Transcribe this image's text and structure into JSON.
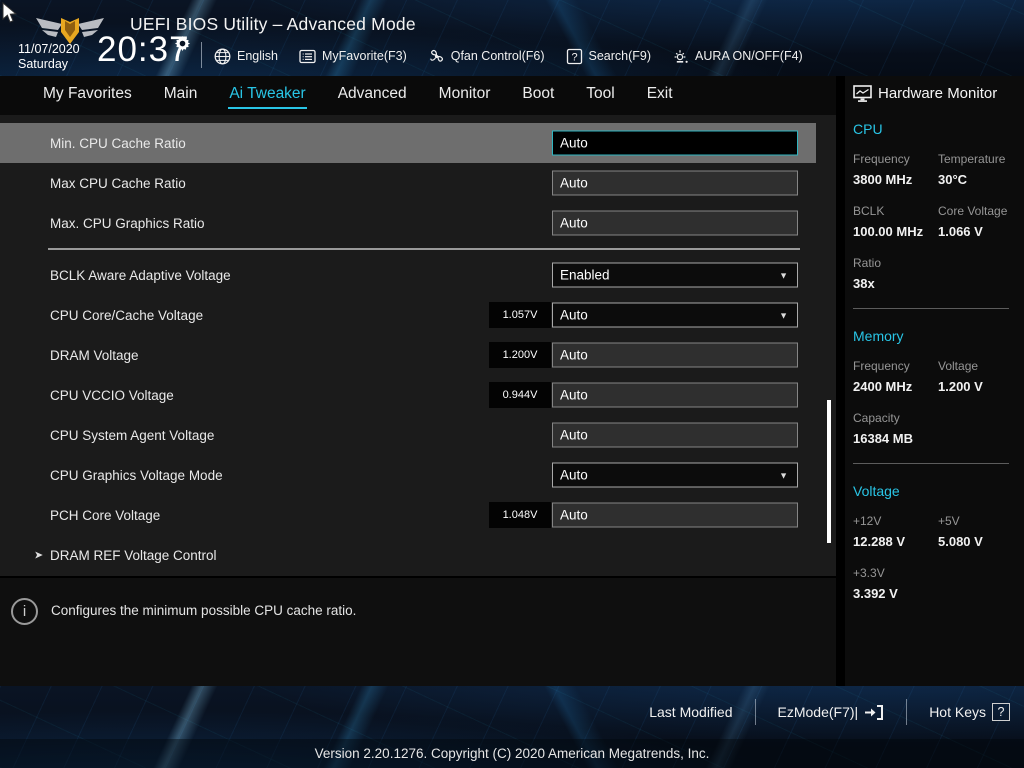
{
  "colors": {
    "accent_cyan": "#29c5e6",
    "selected_row": "#6e6e6e",
    "selected_border": "#2fb5c0"
  },
  "icons": {
    "caret_down": "▼",
    "submenu_arrow": "➤",
    "info_glyph": "i"
  },
  "header": {
    "title": "UEFI BIOS Utility – Advanced Mode",
    "date": "11/07/2020",
    "day": "Saturday",
    "time": "20:37",
    "toolbar": [
      {
        "label": "English",
        "icon": "globe-icon"
      },
      {
        "label": "MyFavorite(F3)",
        "icon": "myfavorite-icon"
      },
      {
        "label": "Qfan Control(F6)",
        "icon": "qfan-icon"
      },
      {
        "label": "Search(F9)",
        "icon": "search-icon"
      },
      {
        "label": "AURA ON/OFF(F4)",
        "icon": "aura-icon"
      }
    ]
  },
  "tabs": [
    {
      "label": "My Favorites",
      "active": false
    },
    {
      "label": "Main",
      "active": false
    },
    {
      "label": "Ai Tweaker",
      "active": true
    },
    {
      "label": "Advanced",
      "active": false
    },
    {
      "label": "Monitor",
      "active": false
    },
    {
      "label": "Boot",
      "active": false
    },
    {
      "label": "Tool",
      "active": false
    },
    {
      "label": "Exit",
      "active": false
    }
  ],
  "settings": {
    "rows": [
      {
        "label": "Min. CPU Cache Ratio",
        "value": "Auto",
        "control": "input",
        "selected": true
      },
      {
        "label": "Max CPU Cache Ratio",
        "value": "Auto",
        "control": "input"
      },
      {
        "label": "Max. CPU Graphics Ratio",
        "value": "Auto",
        "control": "input"
      },
      {
        "label": "BCLK Aware Adaptive Voltage",
        "value": "Enabled",
        "control": "dropdown",
        "separator_before": true
      },
      {
        "label": "CPU Core/Cache Voltage",
        "chip": "1.057V",
        "value": "Auto",
        "control": "dropdown"
      },
      {
        "label": "DRAM Voltage",
        "chip": "1.200V",
        "value": "Auto",
        "control": "input"
      },
      {
        "label": "CPU VCCIO Voltage",
        "chip": "0.944V",
        "value": "Auto",
        "control": "input"
      },
      {
        "label": "CPU System Agent Voltage",
        "value": "Auto",
        "control": "input"
      },
      {
        "label": "CPU Graphics Voltage Mode",
        "value": "Auto",
        "control": "dropdown"
      },
      {
        "label": "PCH Core Voltage",
        "chip": "1.048V",
        "value": "Auto",
        "control": "input"
      },
      {
        "label": "DRAM REF Voltage Control",
        "control": "submenu"
      }
    ]
  },
  "info": {
    "text": "Configures the minimum possible CPU cache ratio."
  },
  "hardware_monitor": {
    "title": "Hardware Monitor",
    "sections": [
      {
        "name": "CPU",
        "groups": [
          [
            {
              "label": "Frequency",
              "value": "3800 MHz"
            },
            {
              "label": "Temperature",
              "value": "30°C"
            }
          ],
          [
            {
              "label": "BCLK",
              "value": "100.00 MHz"
            },
            {
              "label": "Core Voltage",
              "value": "1.066 V"
            }
          ],
          [
            {
              "label": "Ratio",
              "value": "38x"
            }
          ]
        ]
      },
      {
        "name": "Memory",
        "groups": [
          [
            {
              "label": "Frequency",
              "value": "2400 MHz"
            },
            {
              "label": "Voltage",
              "value": "1.200 V"
            }
          ],
          [
            {
              "label": "Capacity",
              "value": "16384 MB"
            }
          ]
        ]
      },
      {
        "name": "Voltage",
        "groups": [
          [
            {
              "label": "+12V",
              "value": "12.288 V"
            },
            {
              "label": "+5V",
              "value": "5.080 V"
            }
          ],
          [
            {
              "label": "+3.3V",
              "value": "3.392 V"
            }
          ]
        ]
      }
    ]
  },
  "footer": {
    "last_modified_label": "Last Modified",
    "ezmode_label": "EzMode(F7)|",
    "hot_keys_label": "Hot Keys",
    "hot_keys_badge": "?",
    "version": "Version 2.20.1276. Copyright (C) 2020 American Megatrends, Inc."
  }
}
